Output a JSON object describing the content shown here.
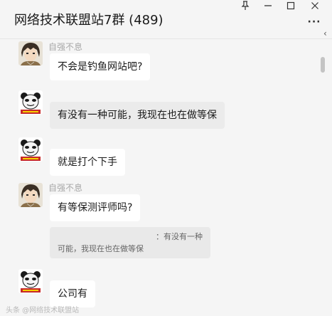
{
  "window": {
    "title": "网络技术联盟站7群 (489)",
    "pin_icon": "pin-icon",
    "minimize_icon": "minimize-icon",
    "maximize_icon": "maximize-icon",
    "close_icon": "close-icon",
    "more_label": "···",
    "side_chevron": "‹"
  },
  "messages": [
    {
      "sender": "自强不息",
      "avatar": "anime-boy-avatar",
      "text": "不会是钓鱼网站吧?"
    },
    {
      "sender": "",
      "avatar": "panda-meme-avatar",
      "text": "有没有一种可能，我现在也在做等保"
    },
    {
      "sender": "",
      "avatar": "panda-meme-avatar",
      "text": "就是打个下手"
    },
    {
      "sender": "自强不息",
      "avatar": "anime-boy-avatar",
      "text": "有等保测评师吗?",
      "quote": {
        "line1": "：有没有一种",
        "line2": "可能，我现在也在做等保"
      }
    },
    {
      "sender": "",
      "avatar": "panda-meme-avatar",
      "text": "公司有"
    }
  ],
  "watermark": "头条 @网络技术联盟站",
  "colors": {
    "background": "#f5f5f5",
    "bubble": "#ffffff",
    "quote": "#e9e9e9",
    "sender": "#a8a8a8"
  }
}
